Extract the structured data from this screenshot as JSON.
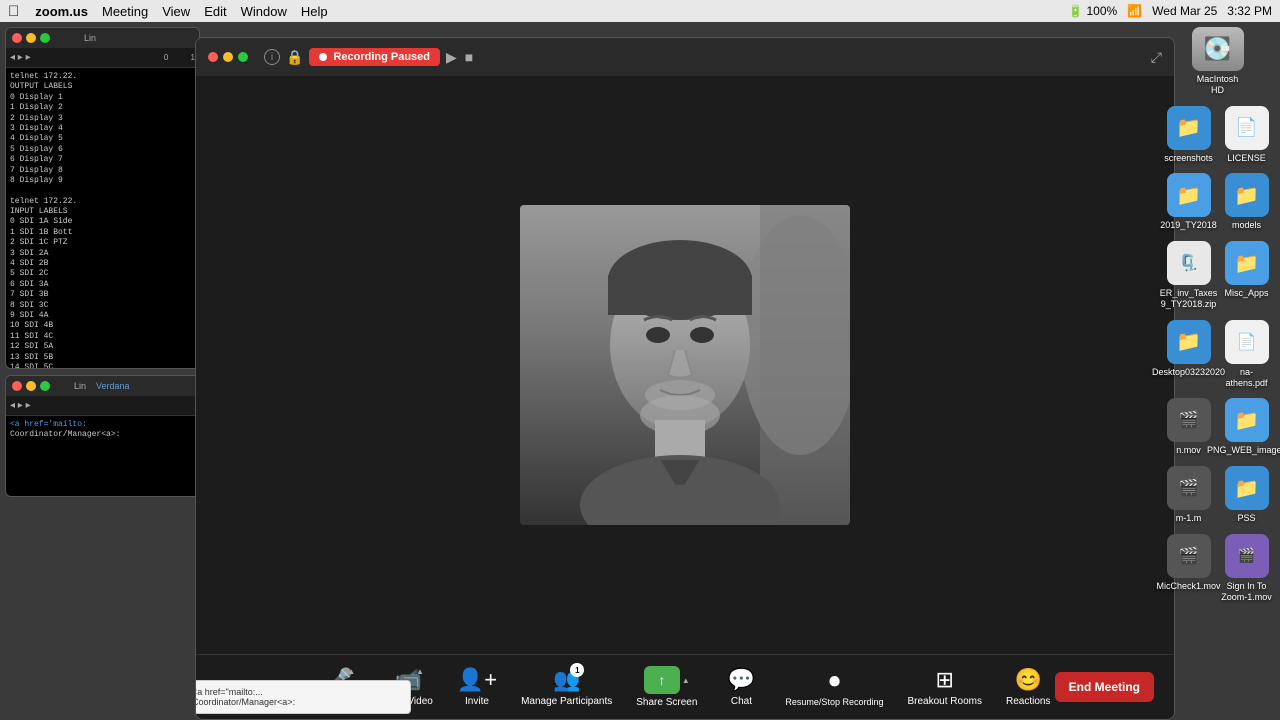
{
  "menubar": {
    "apple": "⌘",
    "app_name": "zoom.us",
    "menus": [
      "Meeting",
      "View",
      "Edit",
      "Window",
      "Help"
    ],
    "right_items": [
      "100%",
      "Wed Mar 25",
      "3:32 PM"
    ]
  },
  "recording": {
    "badge_text": "Recording Paused",
    "status": "paused"
  },
  "toolbar": {
    "mute_label": "Mute",
    "video_label": "Start Video",
    "invite_label": "Invite",
    "participants_label": "Manage Participants",
    "participants_count": "1",
    "share_label": "Share Screen",
    "chat_label": "Chat",
    "recording_label": "Resume/Stop Recording",
    "breakout_label": "Breakout Rooms",
    "reactions_label": "Reactions",
    "end_meeting_label": "End Meeting"
  },
  "terminal1": {
    "lines": [
      "telnet 172.22.",
      "OUTPUT LABELS",
      "0 Display 1",
      "1 Display 2",
      "2 Display 3",
      "3 Display 4",
      "4 Display 5",
      "5 Display 6",
      "6 Display 7",
      "7 Display 8",
      "8 Display 9",
      "",
      "telnet 172.22.",
      "INPUT LABELS",
      "0 SDI 1A Side",
      "1 SDI 1B Bott",
      "2 SDI 1C PTZ",
      "3 SDI 2A",
      "4 SDI 2B",
      "5 SDI 2C",
      "6 SDI 3A",
      "7 SDI 3B",
      "8 SDI 3C",
      "9 SDI 4A",
      "10 SDI 4B",
      "11 SDI 4C",
      "12 SDI 5A",
      "13 SDI 5B",
      "14 SDI 5C"
    ]
  },
  "terminal2": {
    "lines": [
      "<a href='mailto:",
      "Coordinator/Manager<a>:"
    ]
  },
  "desktop_icons": [
    {
      "label": "MacIntosh HD",
      "type": "hd"
    },
    {
      "label": "screenshots",
      "type": "folder"
    },
    {
      "label": "LICENSE",
      "type": "doc"
    },
    {
      "label": "2019_TY2018",
      "type": "folder"
    },
    {
      "label": "models",
      "type": "folder"
    },
    {
      "label": "ER_inv_Taxes 9_TY2018.zip",
      "type": "zip"
    },
    {
      "label": "Misc_Apps",
      "type": "folder"
    },
    {
      "label": "Desktop03232020",
      "type": "folder"
    },
    {
      "label": "na- athens.pdf",
      "type": "doc"
    },
    {
      "label": "n.mov",
      "type": "mov"
    },
    {
      "label": "PNG_WEB_images",
      "type": "folder"
    },
    {
      "label": "m-1.m",
      "type": "file"
    },
    {
      "label": "PSS",
      "type": "folder"
    },
    {
      "label": "MicCheck1.mov",
      "type": "mov"
    },
    {
      "label": "Sign In To Zoom-1.mov",
      "type": "mov"
    }
  ],
  "colors": {
    "recording_red": "#e53935",
    "folder_blue": "#3a8fd4",
    "share_green": "#4caf50",
    "end_red": "#c62828",
    "toolbar_bg": "#1c1c1c",
    "menubar_bg": "#e8e8e8"
  }
}
